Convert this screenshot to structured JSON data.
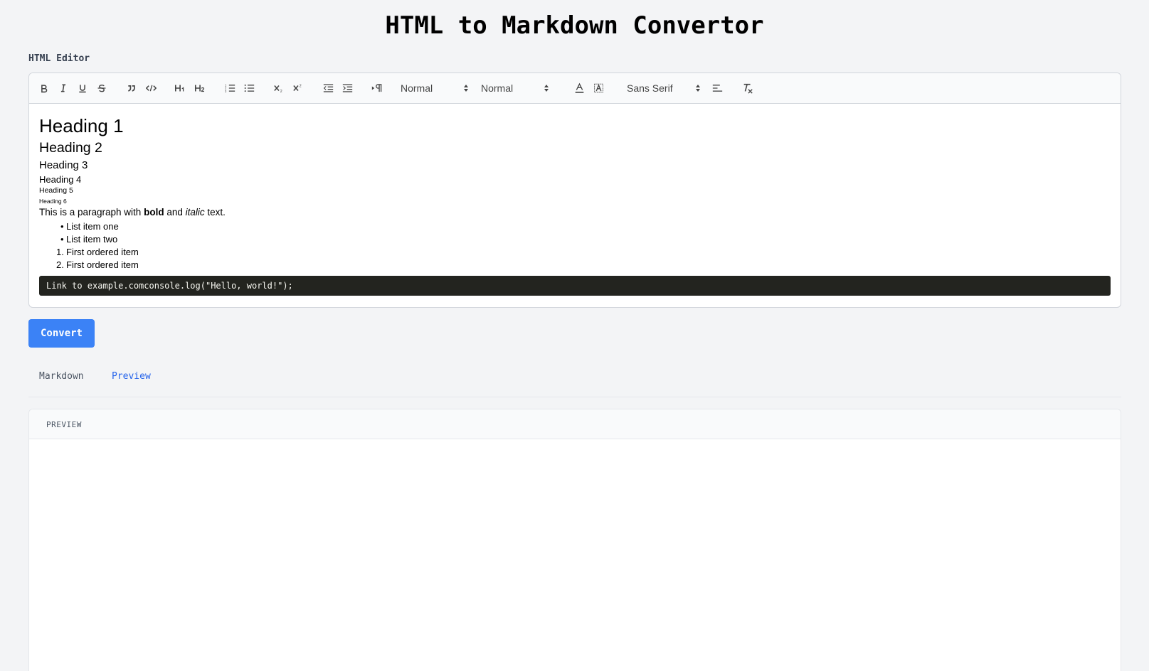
{
  "app": {
    "title": "HTML to Markdown Convertor"
  },
  "editor": {
    "label": "HTML Editor",
    "toolbar": {
      "header_select": "Normal",
      "size_select": "Normal",
      "font_select": "Sans Serif"
    },
    "content": {
      "h1": "Heading 1",
      "h2": "Heading 2",
      "h3": "Heading 3",
      "h4": "Heading 4",
      "h5": "Heading 5",
      "h6": "Heading 6",
      "paragraph": {
        "before": "This is a paragraph with ",
        "bold": "bold",
        "middle": " and ",
        "italic": "italic",
        "after": " text."
      },
      "unordered": [
        "List item one",
        "List item two"
      ],
      "ordered": [
        "First ordered item",
        "First ordered item"
      ],
      "code": "Link to example.comconsole.log(\"Hello, world!\");"
    }
  },
  "convert_label": "Convert",
  "tabs": {
    "markdown": "Markdown",
    "preview": "Preview"
  },
  "preview": {
    "header": "PREVIEW"
  },
  "colors": {
    "accent": "#3b82f6",
    "active_tab": "#2563eb",
    "code_bg": "#23241f",
    "background": "#f3f4f6"
  },
  "icons": [
    "bold-icon",
    "italic-icon",
    "underline-icon",
    "strike-icon",
    "blockquote-icon",
    "code-icon",
    "h1-icon",
    "h2-icon",
    "ordered-list-icon",
    "bullet-list-icon",
    "subscript-icon",
    "superscript-icon",
    "outdent-icon",
    "indent-icon",
    "rtl-icon",
    "text-color-icon",
    "background-color-icon",
    "align-icon",
    "clean-format-icon"
  ]
}
